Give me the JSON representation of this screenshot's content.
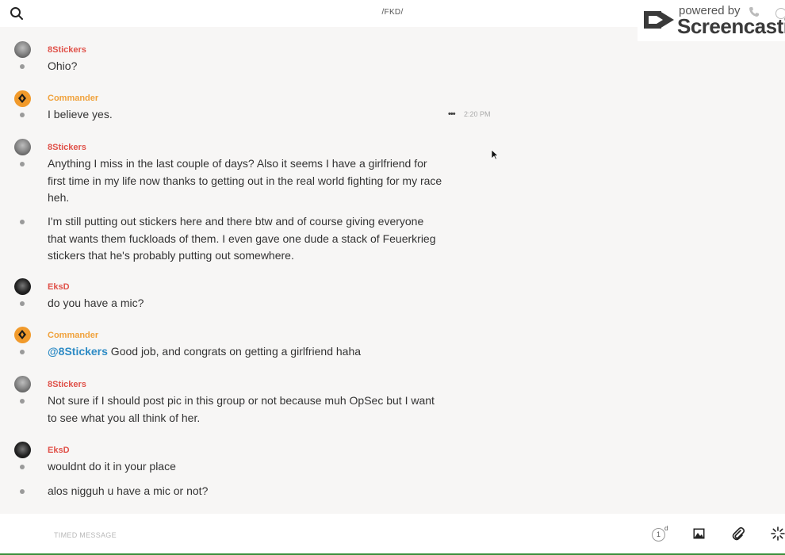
{
  "header": {
    "title": "/FKD/",
    "search_icon": "search-icon"
  },
  "watermark": {
    "powered": "powered by",
    "brand": "Screencastify"
  },
  "messages": {
    "m1": {
      "author": "8Stickers",
      "text": "Ohio?"
    },
    "m2": {
      "author": "Commander",
      "text": "I believe yes.",
      "time": "2:20 PM",
      "more": "•••"
    },
    "m3": {
      "author": "8Stickers",
      "text": "Anything I miss in the last couple of days? Also it seems I have a girlfriend for first time in my life now thanks to getting out in the real world fighting for my race heh."
    },
    "m4": {
      "text": "I'm still putting out stickers here and there btw and of course giving everyone that wants them fuckloads of them. I even gave one dude a stack of Feuerkrieg stickers that he's probably putting out somewhere."
    },
    "m5": {
      "author": "EksD",
      "text": "do you have a mic?"
    },
    "m6": {
      "author": "Commander",
      "mention": "@8Stickers",
      "text": " Good job, and congrats on getting a girlfriend haha"
    },
    "m7": {
      "author": "8Stickers",
      "text": "Not sure if I should post pic in this group or not because muh OpSec but I want to see what you all think of her."
    },
    "m8": {
      "author": "EksD",
      "text": "wouldnt do it in your place"
    },
    "m9": {
      "text": "alos nigguh u have a mic or not?"
    }
  },
  "composer": {
    "placeholder": "TIMED MESSAGE",
    "timer_value": "1",
    "timer_unit": "d"
  },
  "colors": {
    "author_red": "#e0524a",
    "author_orange": "#f0a23c",
    "mention_blue": "#2e8bc5",
    "background": "#f7f6f5"
  }
}
